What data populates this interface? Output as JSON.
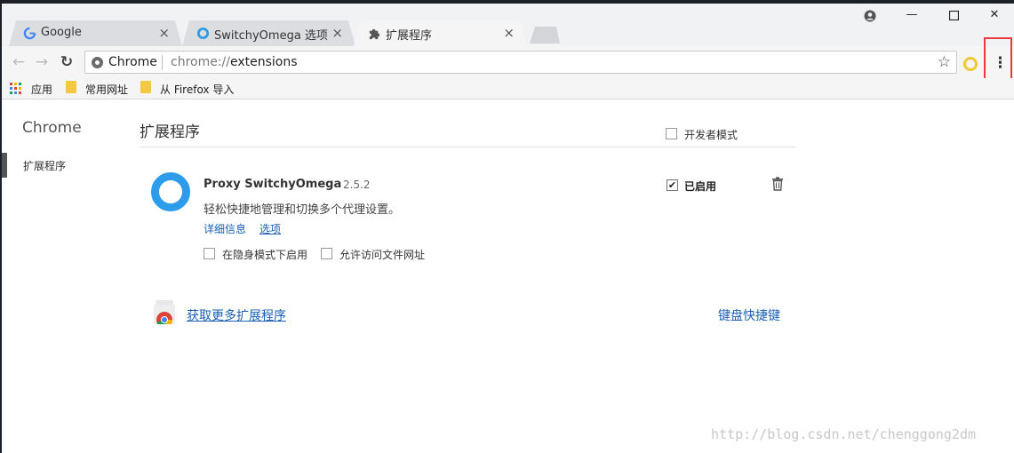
{
  "tabs": [
    {
      "label": "Google",
      "icon": "google-icon"
    },
    {
      "label": "SwitchyOmega 选项",
      "icon": "switchyomega-icon"
    },
    {
      "label": "扩展程序",
      "icon": "puzzle-icon"
    }
  ],
  "tab_close_glyph": "×",
  "window_controls": {
    "account": "●",
    "minimize": "—",
    "maximize": "☐",
    "close": "✕"
  },
  "toolbar": {
    "back": "←",
    "forward": "→",
    "reload": "↻",
    "omnibox_chip": "Chrome",
    "url_scheme": "chrome://",
    "url_path": "extensions",
    "star": "☆",
    "menu": "⋮"
  },
  "bookmarks": [
    {
      "label": "应用"
    },
    {
      "label": "常用网址"
    },
    {
      "label": "从 Firefox 导入"
    }
  ],
  "sidebar": {
    "title": "Chrome",
    "items": [
      {
        "label": "扩展程序"
      }
    ]
  },
  "main": {
    "title": "扩展程序",
    "developer_mode_label": "开发者模式",
    "extension": {
      "name": "Proxy SwitchyOmega",
      "version": "2.5.2",
      "description": "轻松快捷地管理和切换多个代理设置。",
      "details_link": "详细信息",
      "options_link": "选项",
      "incognito_label": "在隐身模式下启用",
      "file_access_label": "允许访问文件网址",
      "enabled_label": "已启用",
      "enabled_check": "✔"
    },
    "more_extensions_link": "获取更多扩展程序",
    "keyboard_shortcuts_link": "键盘快捷键"
  },
  "watermark": "http://blog.csdn.net/chenggong2dm",
  "colors": {
    "accent": "#2d9cea",
    "link": "#1a5fb4",
    "highlight": "#e83c3c"
  }
}
